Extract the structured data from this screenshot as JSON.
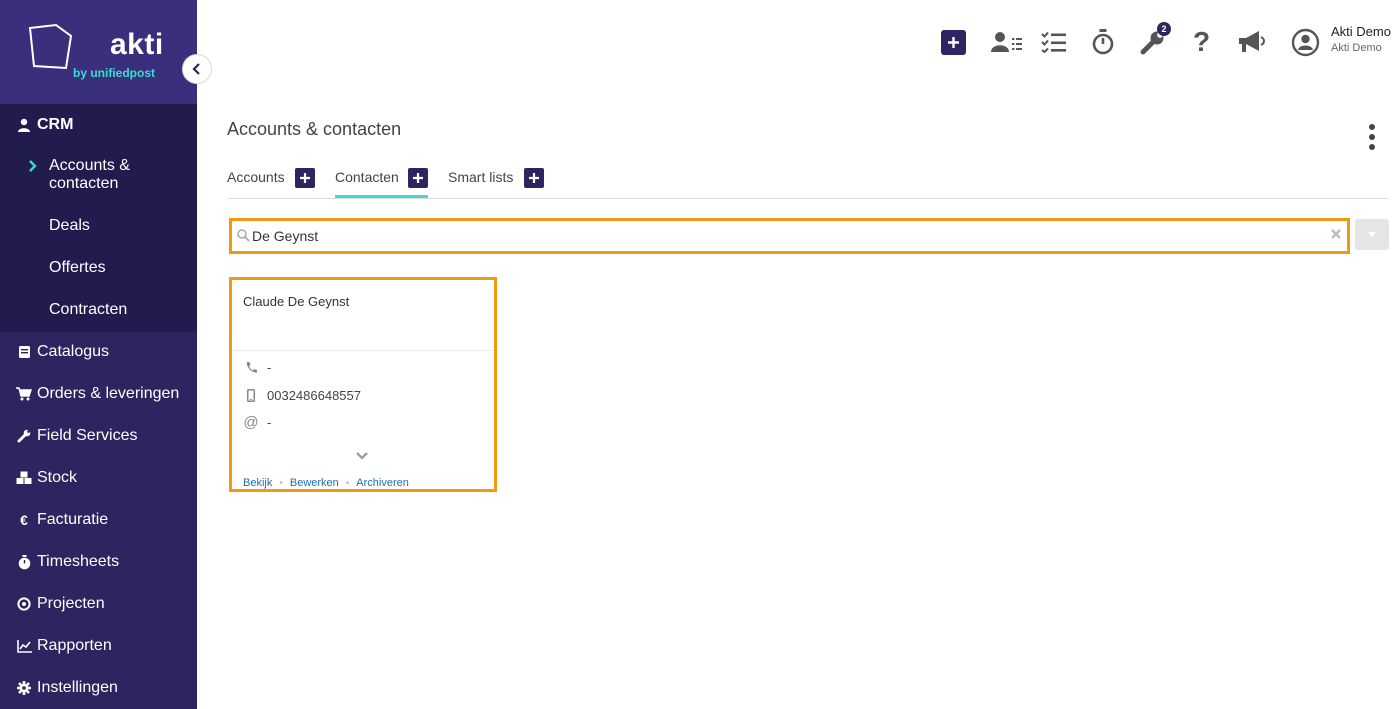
{
  "brand": {
    "name": "akti",
    "sub": "by unifiedpost",
    "accent": "#3ddbd0",
    "primary": "#2d2460",
    "highlight": "#f09a12"
  },
  "sidebar": {
    "crm_label": "CRM",
    "crm_sub": [
      {
        "label_line1": "Accounts &",
        "label_line2": "contacten"
      },
      {
        "label": "Deals"
      },
      {
        "label": "Offertes"
      },
      {
        "label": "Contracten"
      }
    ],
    "items": [
      {
        "label": "Catalogus",
        "icon": "book-icon"
      },
      {
        "label": "Orders & leveringen",
        "icon": "cart-icon"
      },
      {
        "label": "Field Services",
        "icon": "wrench-icon"
      },
      {
        "label": "Stock",
        "icon": "boxes-icon"
      },
      {
        "label": "Facturatie",
        "icon": "euro-icon"
      },
      {
        "label": "Timesheets",
        "icon": "stopwatch-icon"
      },
      {
        "label": "Projecten",
        "icon": "target-icon"
      },
      {
        "label": "Rapporten",
        "icon": "chart-icon"
      },
      {
        "label": "Instellingen",
        "icon": "gear-icon"
      }
    ]
  },
  "topbar": {
    "notification_count": "2",
    "user_name": "Akti Demo",
    "user_company": "Akti Demo"
  },
  "main": {
    "title": "Accounts & contacten",
    "tabs": [
      {
        "label": "Accounts"
      },
      {
        "label": "Contacten"
      },
      {
        "label": "Smart lists"
      }
    ],
    "search": {
      "value": "De Geynst"
    },
    "card": {
      "name": "Claude De Geynst",
      "phone": "-",
      "mobile": "0032486648557",
      "email": "-",
      "links": {
        "view": "Bekijk",
        "edit": "Bewerken",
        "archive": "Archiveren"
      }
    }
  }
}
